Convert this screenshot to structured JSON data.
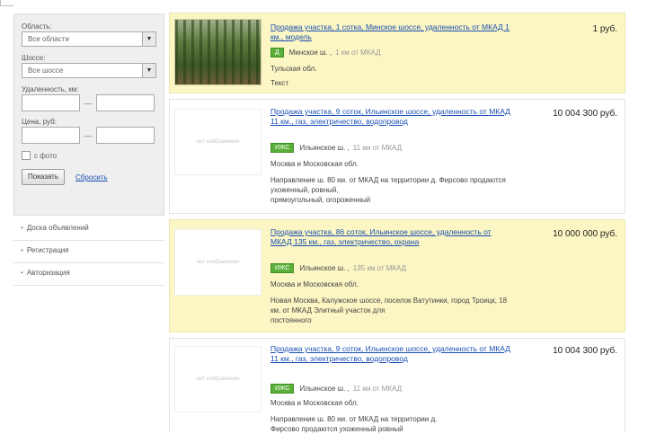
{
  "filters": {
    "region_label": "Область:",
    "region_value": "Все области",
    "highway_label": "Шоссе:",
    "highway_value": "Все шоссе",
    "distance_label": "Удаленность, км:",
    "price_label": "Цена, руб:",
    "range_sep": "—",
    "photo_label": "с фото",
    "apply_label": "Показать",
    "reset_label": "Сбросить"
  },
  "nav": [
    "Доска объявлений",
    "Регистрация",
    "Авторизация"
  ],
  "noimage_text": "нет изображения",
  "listings": [
    {
      "title": "Продажа участка, 1 сотка, Минское шоссе, удаленность от МКАД 1 км., модель",
      "price": "1 руб.",
      "badge": "Д",
      "place": "Минское ш. ,",
      "dist": "1 км от МКАД",
      "line1": "Тульская обл.",
      "line2": "Текст",
      "line3": ""
    },
    {
      "title": "Продажа участка, 9 соток, Ильинское шоссе, удаленность от МКАД 11 км., газ, электричество, водопровод",
      "price": "10 004 300 руб.",
      "badge": "ИЖС",
      "place": "Ильинское ш. ,",
      "dist": "11 км от МКАД",
      "line1": "Москва и Московская обл.",
      "line2": "Направление ш. 80 км. от МКАД на территории д. Фирсово продаются ухоженный, ровный,",
      "line3": "прямоугольный, огороженный"
    },
    {
      "title": "Продажа участка, 86 соток, Ильинское шоссе, удаленность от МКАД 135 км., газ, электричество, охрана",
      "price": "10 000 000 руб.",
      "badge": "ИЖС",
      "place": "Ильинское ш. ,",
      "dist": "135 км от МКАД",
      "line1": "Москва и Московская обл.",
      "line2": "Новая Москва, Калужское шоссе, поселок Ватутинки, город Троицк, 18 км. от МКАД Элитный участок для",
      "line3": "постоянного"
    },
    {
      "title": "Продажа участка, 9 соток, Ильинское шоссе, удаленность от МКАД 11 км., газ, электричество, водопровод",
      "price": "10 004 300 руб.",
      "badge": "ИЖС",
      "place": "Ильинское ш. ,",
      "dist": "11 км от МКАД",
      "line1": "Москва и Московская обл.",
      "line2": "Направление ш. 80 км. от МКАД на территории д.",
      "line3": "Фирсово продаются ухоженный ровный"
    }
  ]
}
